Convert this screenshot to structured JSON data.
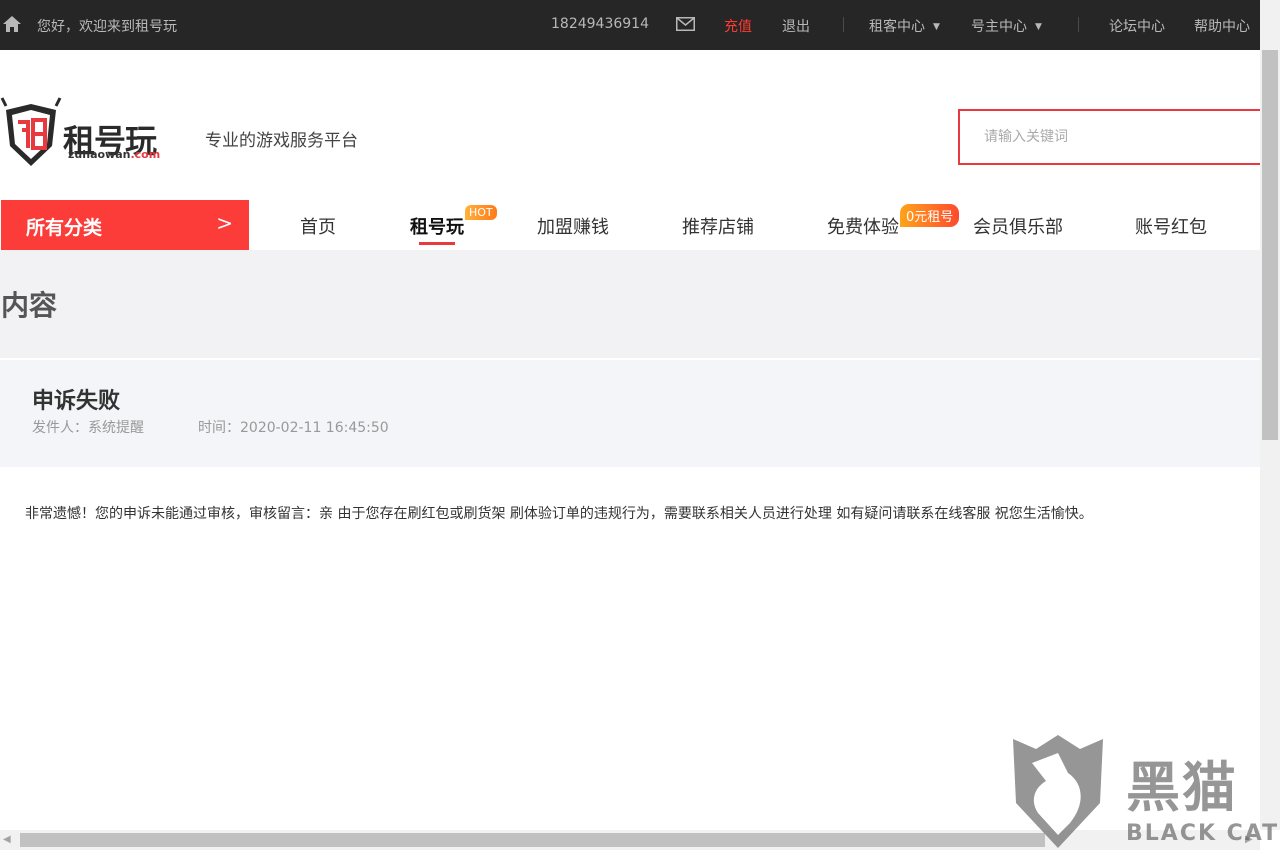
{
  "topbar": {
    "greeting": "您好，欢迎来到租号玩",
    "phone": "18249436914",
    "recharge": "充值",
    "logout": "退出",
    "renter_center": "租客中心",
    "owner_center": "号主中心",
    "forum": "论坛中心",
    "help": "帮助中心"
  },
  "header": {
    "logo_cn": "租号玩",
    "logo_en_main": "zuhaowan",
    "logo_en_tld": ".com",
    "tagline": "专业的游戏服务平台",
    "search_placeholder": "请输入关键词"
  },
  "nav": {
    "all_categories": "所有分类",
    "items": [
      "首页",
      "租号玩",
      "加盟赚钱",
      "推荐店铺",
      "免费体验",
      "会员俱乐部",
      "账号红包"
    ],
    "hot_badge": "HOT",
    "free_badge": "0元租号",
    "active": "租号玩"
  },
  "content": {
    "section_title": "内容",
    "message_title": "申诉失败",
    "sender_label": "发件人：系统提醒",
    "time_label": "时间：2020-02-11 16:45:50",
    "body": "非常遗憾！您的申诉未能通过审核，审核留言：亲 由于您存在刷红包或刷货架 刷体验订单的违规行为，需要联系相关人员进行处理 如有疑问请联系在线客服 祝您生活愉快。"
  },
  "watermark": {
    "cn": "黑猫",
    "en": "BLACK CAT"
  },
  "colors": {
    "topbar_bg": "#262626",
    "accent_red": "#fc3c38",
    "hot_orange": "#ff7a1a"
  }
}
